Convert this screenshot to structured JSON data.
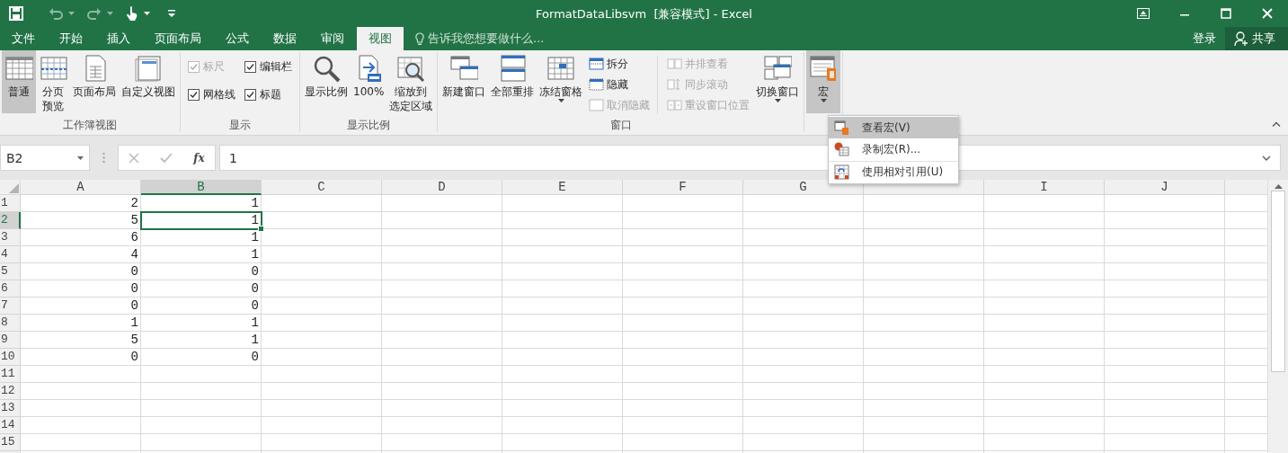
{
  "window": {
    "title": "FormatDataLibsvm  [兼容模式] - Excel"
  },
  "tabs": [
    {
      "label": "文件",
      "selected": false
    },
    {
      "label": "开始",
      "selected": false
    },
    {
      "label": "插入",
      "selected": false
    },
    {
      "label": "页面布局",
      "selected": false
    },
    {
      "label": "公式",
      "selected": false
    },
    {
      "label": "数据",
      "selected": false
    },
    {
      "label": "审阅",
      "selected": false
    },
    {
      "label": "视图",
      "selected": true
    }
  ],
  "tell_me": {
    "placeholder": "告诉我您想要做什么..."
  },
  "account": {
    "sign_in": "登录",
    "share": "共享"
  },
  "ribbon": {
    "groups": [
      {
        "label": "工作簿视图",
        "items": [
          {
            "kind": "large",
            "label": "普通",
            "selected": true,
            "dropdown": false
          },
          {
            "kind": "large",
            "lines": [
              "分页",
              "预览"
            ],
            "selected": false,
            "dropdown": false
          },
          {
            "kind": "large",
            "label": "页面布局",
            "selected": false,
            "dropdown": false
          },
          {
            "kind": "large",
            "label": "自定义视图",
            "selected": false,
            "dropdown": false
          }
        ]
      },
      {
        "label": "显示",
        "items": [
          {
            "kind": "checks",
            "items": [
              {
                "label": "标尺",
                "checked": true,
                "disabled": true
              },
              {
                "label": "编辑栏",
                "checked": true,
                "disabled": false
              },
              {
                "label": "网格线",
                "checked": true,
                "disabled": false
              },
              {
                "label": "标题",
                "checked": true,
                "disabled": false
              }
            ]
          }
        ]
      },
      {
        "label": "显示比例",
        "items": [
          {
            "kind": "large",
            "label": "显示比例",
            "selected": false,
            "dropdown": false
          },
          {
            "kind": "large",
            "label": "100%",
            "selected": false,
            "dropdown": false
          },
          {
            "kind": "large",
            "lines": [
              "缩放到",
              "选定区域"
            ],
            "selected": false,
            "dropdown": false
          }
        ]
      },
      {
        "label": "窗口",
        "items": [
          {
            "kind": "large",
            "label": "新建窗口",
            "selected": false,
            "dropdown": false
          },
          {
            "kind": "large",
            "label": "全部重排",
            "selected": false,
            "dropdown": false
          },
          {
            "kind": "large",
            "label": "冻结窗格",
            "selected": false,
            "dropdown": true
          },
          {
            "kind": "stack",
            "items": [
              {
                "label": "拆分",
                "disabled": false
              },
              {
                "label": "隐藏",
                "disabled": false
              },
              {
                "label": "取消隐藏",
                "disabled": true
              }
            ]
          },
          {
            "kind": "stack",
            "items": [
              {
                "label": "并排查看",
                "disabled": true
              },
              {
                "label": "同步滚动",
                "disabled": true
              },
              {
                "label": "重设窗口位置",
                "disabled": true
              }
            ]
          },
          {
            "kind": "large",
            "label": "切换窗口",
            "selected": false,
            "dropdown": true
          }
        ]
      },
      {
        "items": [
          {
            "kind": "large",
            "label": "宏",
            "selected": true,
            "dropdown": true
          }
        ]
      }
    ]
  },
  "macro_menu": {
    "items": [
      {
        "label": "查看宏(V)",
        "selected": true,
        "separator_before": false
      },
      {
        "label": "录制宏(R)...",
        "selected": false,
        "separator_before": false
      },
      {
        "label": "使用相对引用(U)",
        "selected": false,
        "separator_before": true
      }
    ]
  },
  "formula_bar": {
    "name_box": "B2",
    "function_button": "fx",
    "value": "1"
  },
  "sheet": {
    "columns": [
      {
        "label": "A",
        "selected": false
      },
      {
        "label": "B",
        "selected": true
      },
      {
        "label": "C",
        "selected": false
      },
      {
        "label": "D",
        "selected": false
      },
      {
        "label": "E",
        "selected": false
      },
      {
        "label": "F",
        "selected": false
      },
      {
        "label": "G",
        "selected": false
      },
      {
        "selected": false
      },
      {
        "label": "I",
        "selected": false
      },
      {
        "label": "J",
        "selected": false
      }
    ],
    "rows": [
      {
        "header": "1",
        "selected": false,
        "cells": [
          "2",
          "1"
        ]
      },
      {
        "header": "2",
        "selected": true,
        "cells": [
          "5",
          "1"
        ]
      },
      {
        "header": "3",
        "selected": false,
        "cells": [
          "6",
          "1"
        ]
      },
      {
        "header": "4",
        "selected": false,
        "cells": [
          "4",
          "1"
        ]
      },
      {
        "header": "5",
        "selected": false,
        "cells": [
          "0",
          "0"
        ]
      },
      {
        "header": "6",
        "selected": false,
        "cells": [
          "0",
          "0"
        ]
      },
      {
        "header": "7",
        "selected": false,
        "cells": [
          "0",
          "0"
        ]
      },
      {
        "header": "8",
        "selected": false,
        "cells": [
          "1",
          "1"
        ]
      },
      {
        "header": "9",
        "selected": false,
        "cells": [
          "5",
          "1"
        ]
      },
      {
        "header": "10",
        "selected": false,
        "cells": [
          "0",
          "0"
        ]
      },
      {
        "header": "11",
        "selected": false
      },
      {
        "header": "12",
        "selected": false
      },
      {
        "header": "13",
        "selected": false
      },
      {
        "header": "14",
        "selected": false
      },
      {
        "header": "15",
        "selected": false
      }
    ]
  }
}
